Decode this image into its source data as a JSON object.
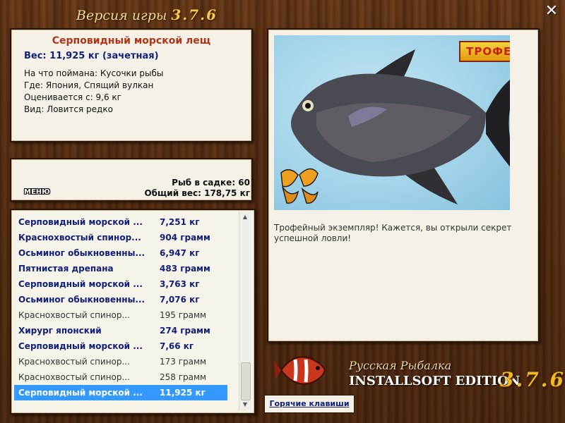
{
  "window": {
    "title_prefix": "Версия игры",
    "title_version": "3.7.6",
    "close_icon": "close-icon"
  },
  "catch_info": {
    "name": "Серповидный морской лещ",
    "weight": "Вес: 11,925 кг (зачетная)",
    "bait": "На что поймана: Кусочки рыбы",
    "place": "Где: Япония, Спящий вулкан",
    "valued_from": "Оценивается с: 9,6 кг",
    "kind": "Вид: Ловится редко"
  },
  "keepnet": {
    "menu_label": "МЕНЮ",
    "fish_count": "Рыб в садке: 60",
    "total_weight": "Общий вес: 178,75 кг"
  },
  "catch_list": [
    {
      "name": "Серповидный морской ...",
      "weight": "7,251 кг",
      "style": "bold"
    },
    {
      "name": "Краснохвостый спинор...",
      "weight": "904 грамм",
      "style": "bold"
    },
    {
      "name": "Осьминог обыкновенны...",
      "weight": "6,947 кг",
      "style": "bold"
    },
    {
      "name": "Пятнистая дрепана",
      "weight": "483 грамм",
      "style": "bold"
    },
    {
      "name": "Серповидный морской ...",
      "weight": "3,763 кг",
      "style": "bold"
    },
    {
      "name": "Осьминог обыкновенны...",
      "weight": "7,076 кг",
      "style": "bold"
    },
    {
      "name": "Краснохвостый спинор...",
      "weight": "195 грамм",
      "style": "normal"
    },
    {
      "name": "Хирург японский",
      "weight": "274 грамм",
      "style": "bold"
    },
    {
      "name": "Серповидный морской ...",
      "weight": "7,66 кг",
      "style": "bold"
    },
    {
      "name": "Краснохвостый спинор...",
      "weight": "173 грамм",
      "style": "normal"
    },
    {
      "name": "Краснохвостый спинор...",
      "weight": "258 грамм",
      "style": "normal"
    },
    {
      "name": "Серповидный морской ...",
      "weight": "11,925 кг",
      "style": "selected"
    }
  ],
  "photo": {
    "trophy_badge": "ТРОФЕЙ",
    "message": "Трофейный экземпляр! Кажется, вы открыли секрет успешной ловли!"
  },
  "footer": {
    "hotkeys_label": "Горячие клавиши",
    "brand_line1": "Русская Рыбалка",
    "brand_line2": "INSTALLSOFT EDITION",
    "brand_version": "3.7.6"
  },
  "colors": {
    "accent_title": "#b0341a",
    "accent_blue": "#11207a",
    "selection": "#3399ff",
    "gold": "#f1b81f"
  }
}
